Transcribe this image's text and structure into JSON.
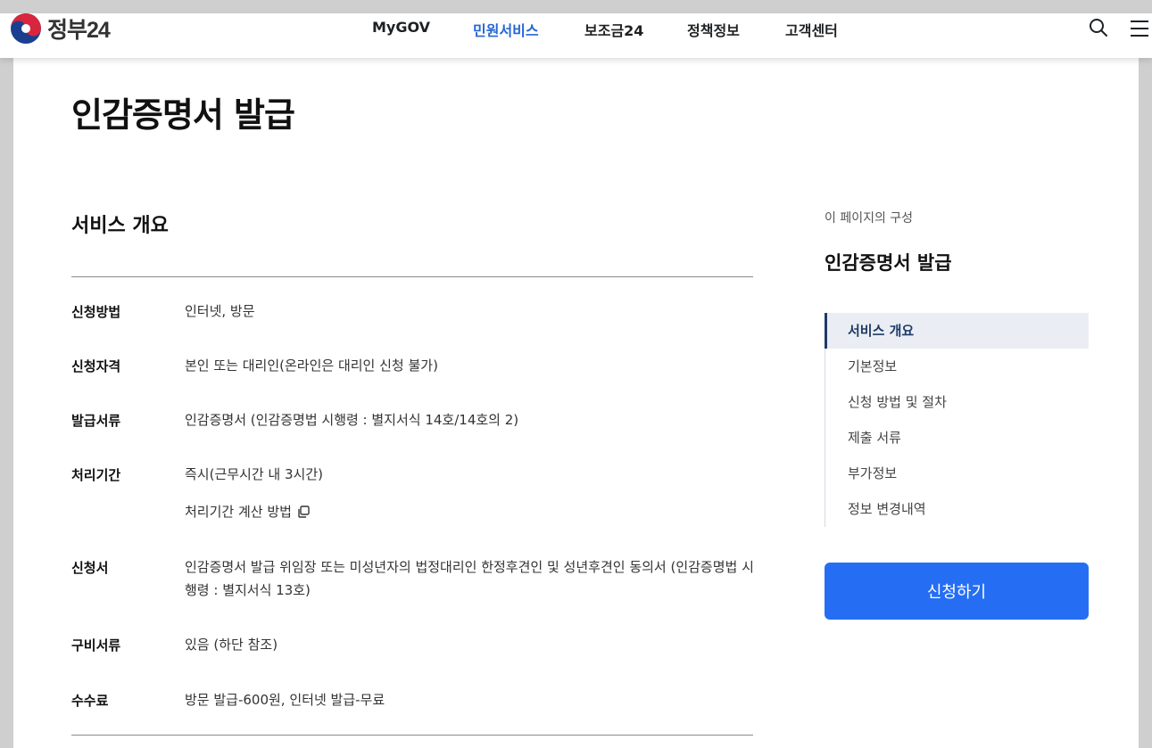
{
  "header": {
    "logo_text": "정부24",
    "nav": [
      {
        "label": "MyGOV",
        "active": false
      },
      {
        "label": "민원서비스",
        "active": true
      },
      {
        "label": "보조금24",
        "active": false
      },
      {
        "label": "정책정보",
        "active": false
      },
      {
        "label": "고객센터",
        "active": false
      }
    ],
    "icons": [
      "search-icon",
      "menu-icon"
    ]
  },
  "page_title": "인감증명서 발급",
  "overview": {
    "title": "서비스 개요",
    "rows": [
      {
        "label": "신청방법",
        "value": "인터넷, 방문"
      },
      {
        "label": "신청자격",
        "value": "본인 또는 대리인(온라인은 대리인 신청 불가)"
      },
      {
        "label": "발급서류",
        "value": "인감증명서 (인감증명법 시행령 : 별지서식 14호/14호의 2)"
      },
      {
        "label": "처리기간",
        "value": "즉시(근무시간 내 3시간)"
      },
      {
        "label": "신청서",
        "value": "인감증명서 발급 위임장 또는 미성년자의 법정대리인 한정후견인 및 성년후견인 동의서 (인감증명법 시행령 : 별지서식 13호)"
      },
      {
        "label": "구비서류",
        "value": "있음 (하단 참조)"
      },
      {
        "label": "수수료",
        "value": "방문 발급-600원, 인터넷 발급-무료"
      }
    ],
    "processing_link": "처리기간 계산 방법"
  },
  "toc": {
    "caption": "이 페이지의 구성",
    "title": "인감증명서 발급",
    "items": [
      {
        "label": "서비스 개요",
        "active": true
      },
      {
        "label": "기본정보",
        "active": false
      },
      {
        "label": "신청 방법 및 절차",
        "active": false
      },
      {
        "label": "제출 서류",
        "active": false
      },
      {
        "label": "부가정보",
        "active": false
      },
      {
        "label": "정보 변경내역",
        "active": false
      }
    ]
  },
  "apply_button": "신청하기",
  "colors": {
    "accent": "#256ef4",
    "nav_active": "#2567d5",
    "toc_active": "#1f3a66"
  }
}
